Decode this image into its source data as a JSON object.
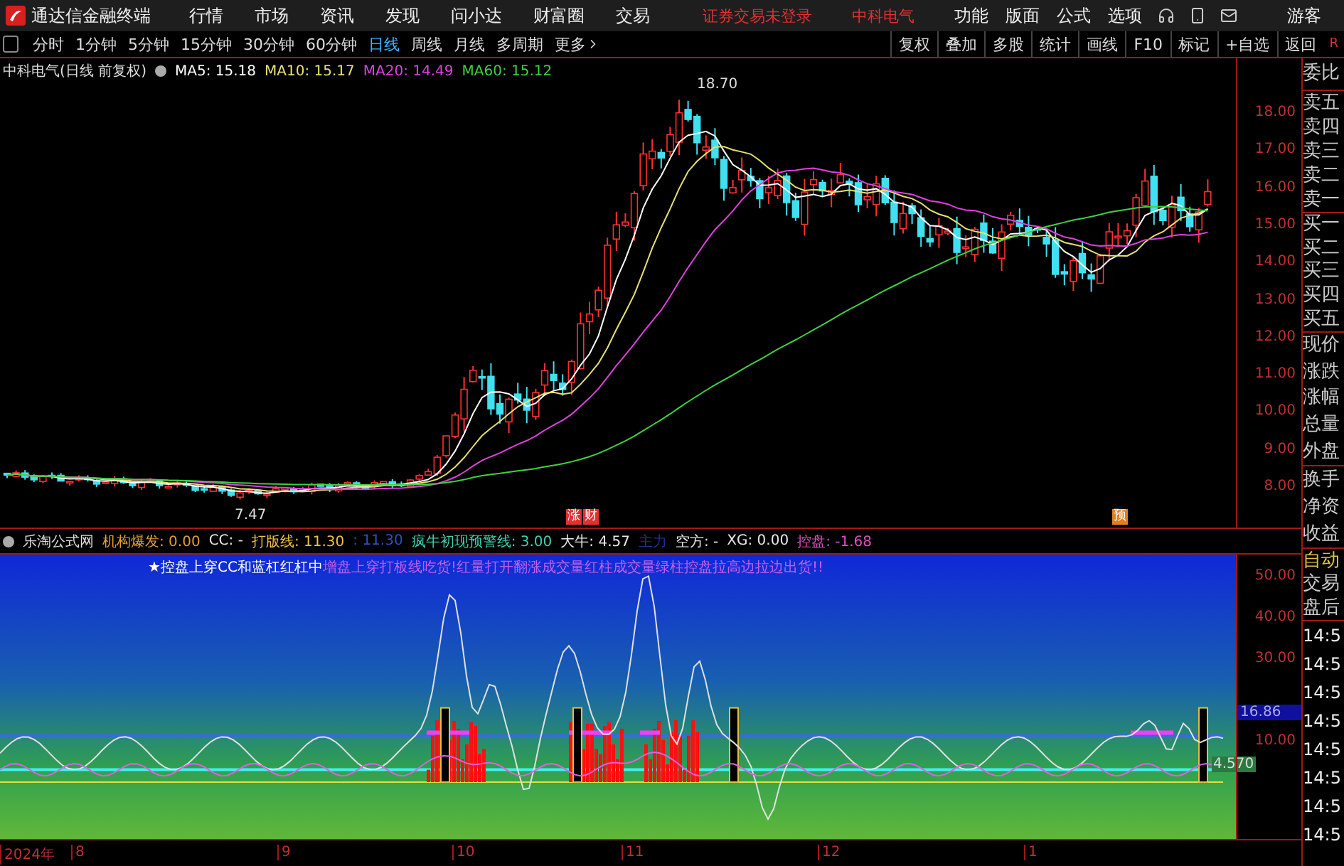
{
  "app": {
    "title": "通达信金融终端"
  },
  "menu": [
    "行情",
    "市场",
    "资讯",
    "发现",
    "问小达",
    "财富圈",
    "交易"
  ],
  "login_status": "证券交易未登录",
  "stock_name": "中科电气",
  "top_actions": [
    "功能",
    "版面",
    "公式",
    "选项"
  ],
  "user": "游客",
  "periods": [
    {
      "label": "分时",
      "selected": false
    },
    {
      "label": "1分钟",
      "selected": false
    },
    {
      "label": "5分钟",
      "selected": false
    },
    {
      "label": "15分钟",
      "selected": false
    },
    {
      "label": "30分钟",
      "selected": false
    },
    {
      "label": "60分钟",
      "selected": false
    },
    {
      "label": "日线",
      "selected": true
    },
    {
      "label": "周线",
      "selected": false
    },
    {
      "label": "月线",
      "selected": false
    },
    {
      "label": "多周期",
      "selected": false
    },
    {
      "label": "更多",
      "selected": false
    }
  ],
  "tools": [
    "复权",
    "叠加",
    "多股",
    "统计",
    "画线",
    "F10",
    "标记",
    "+自选",
    "返回"
  ],
  "corner": "R",
  "main_chart": {
    "title": "中科电气(日线 前复权)",
    "ma": [
      {
        "label": "MA5: 15.18",
        "color": "#ffffff"
      },
      {
        "label": "MA10: 15.17",
        "color": "#e8e070"
      },
      {
        "label": "MA20: 14.49",
        "color": "#e040e0"
      },
      {
        "label": "MA60: 15.12",
        "color": "#40d040"
      }
    ],
    "high_label": "18.70",
    "low_label": "7.47",
    "price_ticks": [
      "18.00",
      "17.00",
      "16.00",
      "15.00",
      "14.00",
      "13.00",
      "12.00",
      "11.00",
      "10.00",
      "9.00",
      "8.00"
    ],
    "markers": [
      {
        "text": "涨",
        "color": "#e03030"
      },
      {
        "text": "财",
        "color": "#e03030"
      },
      {
        "text": "预",
        "color": "#e08020"
      }
    ]
  },
  "indicator": {
    "name": "乐淘公式网",
    "values": [
      {
        "text": "机构爆发: 0.00",
        "color": "#e0a030"
      },
      {
        "text": "CC: -",
        "color": "#e8e8e8"
      },
      {
        "text": "打版线: 11.30",
        "color": "#f0c040"
      },
      {
        "text": ": 11.30",
        "color": "#3050c0"
      },
      {
        "text": "疯牛初现预警线: 3.00",
        "color": "#40d0b0"
      },
      {
        "text": "大牛: 4.57",
        "color": "#e8e8e8"
      },
      {
        "text": "主力",
        "color": "#2030a0"
      },
      {
        "text": "空方: -",
        "color": "#e8e8e8"
      },
      {
        "text": "XG: 0.00",
        "color": "#e8e8e8"
      },
      {
        "text": "控盘: -1.68",
        "color": "#e050c0"
      }
    ],
    "banner": [
      {
        "text": "★控盘上穿CC和蓝杠红杠中",
        "color": "#ffffff"
      },
      {
        "text": "增盘上穿打板线吃货!红量打开翻涨成交量红柱成交量绿柱控盘拉高边拉边出货!!",
        "color": "#c060f0"
      }
    ],
    "ticks": [
      "50.00",
      "40.00",
      "30.00",
      "10.00"
    ],
    "current": "16.86",
    "small_label": "4.570"
  },
  "time_axis": [
    "2024年",
    "8",
    "9",
    "10",
    "11",
    "12",
    "1"
  ],
  "side_panel": {
    "groups": [
      [
        "委比"
      ],
      [
        "卖五",
        "卖四",
        "卖三",
        "卖二",
        "卖一"
      ],
      [
        "买一",
        "买二",
        "买三",
        "买四",
        "买五"
      ],
      [
        "现价",
        "涨跌",
        "涨幅",
        "总量",
        "外盘"
      ],
      [
        "换手",
        "净资",
        "收益"
      ]
    ],
    "modes": [
      {
        "label": "自动",
        "selected": true
      },
      {
        "label": "交易",
        "selected": false
      },
      {
        "label": "盘后",
        "selected": false
      }
    ],
    "times": [
      "14:5",
      "14:5",
      "14:5",
      "14:5",
      "14:5",
      "14:5",
      "14:5",
      "14:5"
    ]
  }
}
